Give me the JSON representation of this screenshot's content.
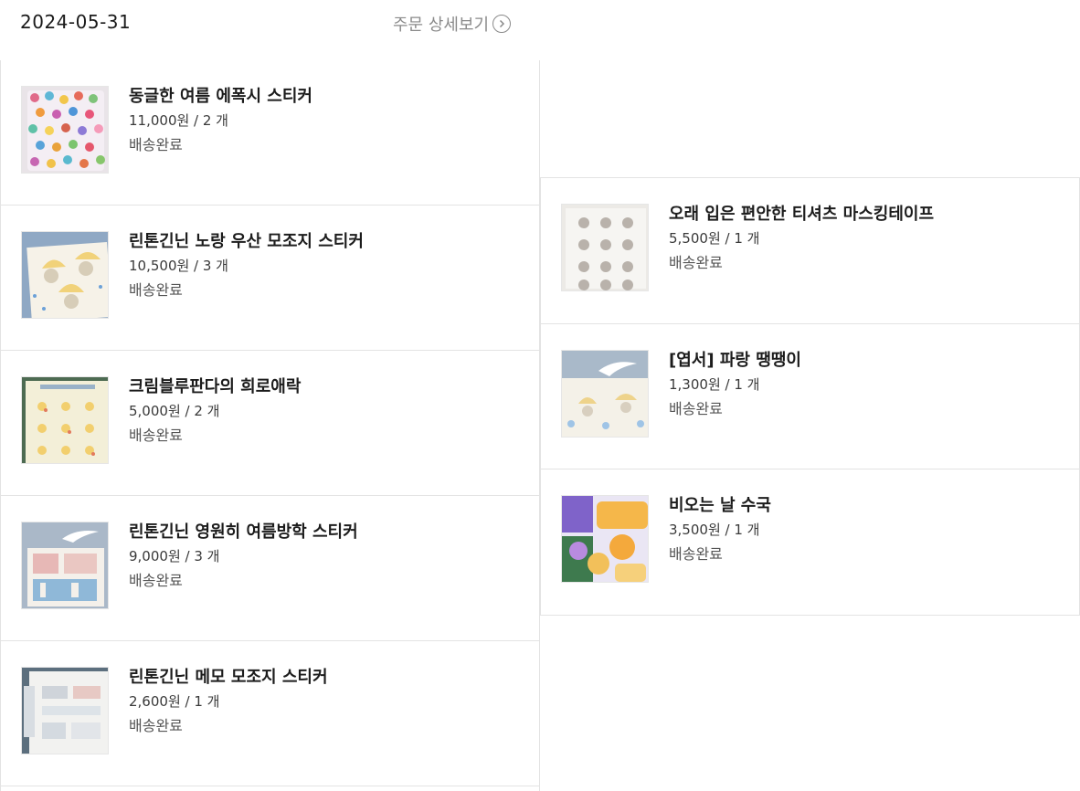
{
  "order": {
    "date": "2024-05-31",
    "detail_link_label": "주문 상세보기"
  },
  "left_items": [
    {
      "name": "동글한 여름 에폭시 스티커",
      "price": "11,000원 / 2 개",
      "status": "배송완료",
      "thumb_icon": "epoxy-sticker-photo"
    },
    {
      "name": "린톤긴닌 노랑 우산 모조지 스티커",
      "price": "10,500원 / 3 개",
      "status": "배송완료",
      "thumb_icon": "yellow-umbrella-sticker-photo"
    },
    {
      "name": "크림블루판다의 희로애락",
      "price": "5,000원 / 2 개",
      "status": "배송완료",
      "thumb_icon": "panda-sticker-photo"
    },
    {
      "name": "린톤긴닌 영원히 여름방학 스티커",
      "price": "9,000원 / 3 개",
      "status": "배송완료",
      "thumb_icon": "summer-vacation-sticker-photo"
    },
    {
      "name": "린톤긴닌 메모 모조지 스티커",
      "price": "2,600원 / 1 개",
      "status": "배송완료",
      "thumb_icon": "memo-sticker-photo"
    }
  ],
  "right_items": [
    {
      "name": "오래 입은 편안한 티셔츠 마스킹테이프",
      "price": "5,500원 / 1 개",
      "status": "배송완료",
      "thumb_icon": "masking-tape-photo"
    },
    {
      "name": "[엽서] 파랑 땡땡이",
      "price": "1,300원 / 1 개",
      "status": "배송완료",
      "thumb_icon": "postcard-photo"
    },
    {
      "name": "비오는 날 수국",
      "price": "3,500원 / 1 개",
      "status": "배송완료",
      "thumb_icon": "hydrangea-sticker-photo"
    }
  ]
}
